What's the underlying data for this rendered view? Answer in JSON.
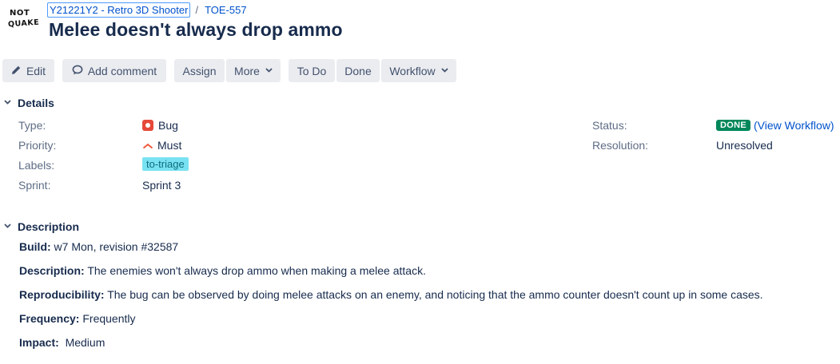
{
  "logo": {
    "line1": "NOT",
    "line2": "QUAKE"
  },
  "breadcrumb": {
    "project": "Y21221Y2 - Retro 3D Shooter",
    "separator": "/",
    "issue_key": "TOE-557"
  },
  "title": "Melee doesn't always drop ammo",
  "toolbar": {
    "edit": "Edit",
    "add_comment": "Add comment",
    "assign": "Assign",
    "more": "More",
    "todo": "To Do",
    "done": "Done",
    "workflow": "Workflow"
  },
  "details": {
    "heading": "Details",
    "type_label": "Type:",
    "type_value": "Bug",
    "priority_label": "Priority:",
    "priority_value": "Must",
    "labels_label": "Labels:",
    "labels_value": "to-triage",
    "sprint_label": "Sprint:",
    "sprint_value": "Sprint 3",
    "status_label": "Status:",
    "status_badge": "DONE",
    "status_link": "(View Workflow)",
    "resolution_label": "Resolution:",
    "resolution_value": "Unresolved"
  },
  "description": {
    "heading": "Description",
    "build_label": "Build:",
    "build_value": " w7 Mon, revision #32587",
    "desc_label": "Description:",
    "desc_value": " The enemies won't always drop ammo when making a melee attack.",
    "repro_label": "Reproducibility:",
    "repro_value": " The bug can be observed by doing melee attacks on an enemy, and noticing that the ammo counter doesn't count up in some cases.",
    "freq_label": "Frequency:",
    "freq_value": " Frequently",
    "impact_label": "Impact:",
    "impact_value": "  Medium"
  },
  "colors": {
    "link": "#0052cc",
    "done_badge": "#00875a",
    "bug": "#e5493a",
    "label_tag": "#79e2f2"
  },
  "icons": {
    "edit": "pencil-icon",
    "comment": "comment-bubble-icon",
    "dropdown": "chevron-down-icon",
    "section": "chevron-down-icon",
    "type": "bug-icon",
    "priority": "priority-high-icon"
  }
}
